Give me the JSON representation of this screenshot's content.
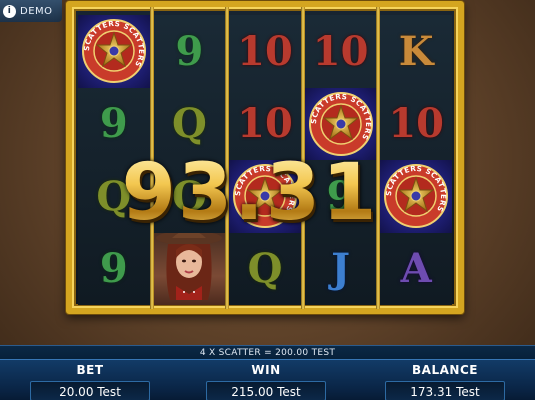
{
  "demo_badge": {
    "label": "DEMO",
    "icon": "info-icon"
  },
  "reels": [
    [
      "scatter",
      "9",
      "Q",
      "9"
    ],
    [
      "9",
      "Q",
      "Q",
      "cowgirl"
    ],
    [
      "10",
      "10",
      "scatter",
      "Q"
    ],
    [
      "10",
      "scatter",
      "9",
      "J"
    ],
    [
      "K",
      "10",
      "scatter",
      "A"
    ]
  ],
  "scatter_symbol": {
    "text": "SCATTERS"
  },
  "win_amount": "93.31",
  "status_message": "4 X SCATTER = 200.00 TEST",
  "bottom": {
    "bet": {
      "label": "BET",
      "value": "20.00 Test"
    },
    "win": {
      "label": "WIN",
      "value": "215.00 Test"
    },
    "balance": {
      "label": "BALANCE",
      "value": "173.31 Test"
    }
  },
  "colors": {
    "frame_gold": "#d4a520",
    "bar_blue": "#0a2546",
    "win_gold": "#f3c750"
  }
}
